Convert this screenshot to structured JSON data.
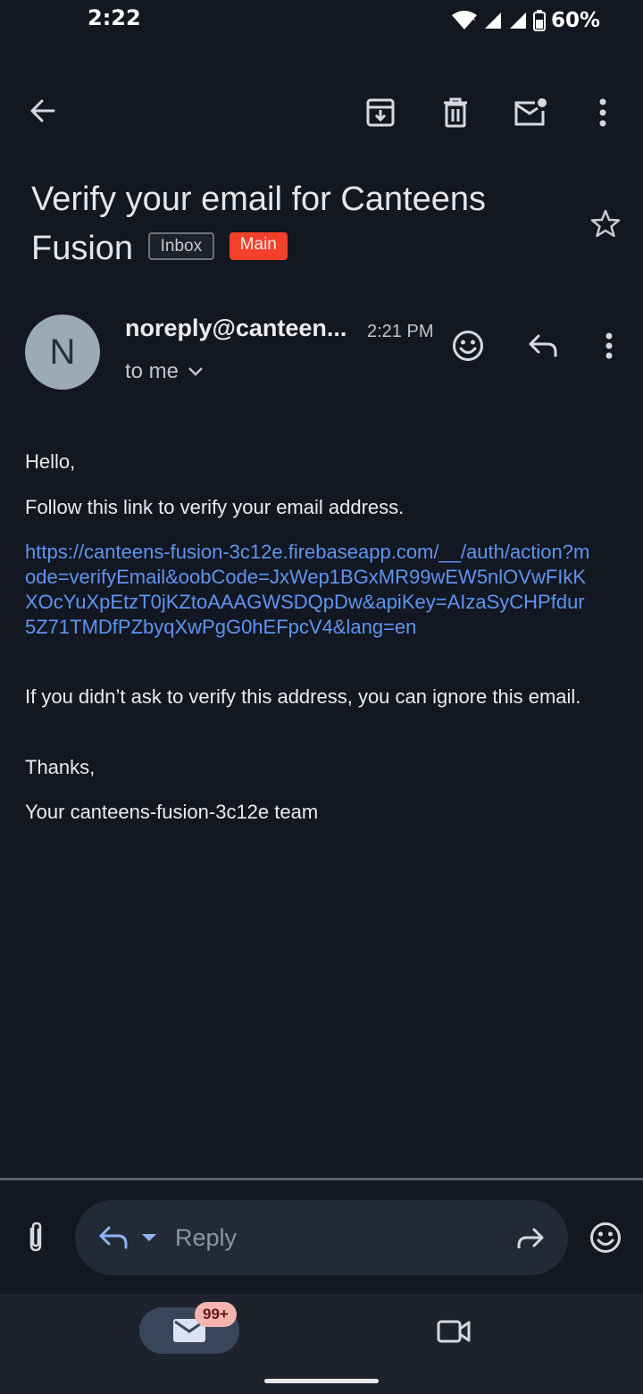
{
  "status_bar": {
    "time": "2:22",
    "battery_percent": "60%"
  },
  "email": {
    "subject": "Verify your email for Canteens Fusion",
    "labels": [
      "Inbox",
      "Main"
    ],
    "sender_initial": "N",
    "sender": "noreply@canteen...",
    "time": "2:21 PM",
    "recipient": "to me",
    "body": {
      "greeting": "Hello,",
      "instruction": "Follow this link to verify your email address.",
      "link": "https://canteens-fusion-3c12e.firebaseapp.com/__/auth/action?mode=verifyEmail&oobCode=JxWep1BGxMR99wEW5nlOVwFIkKXOcYuXpEtzT0jKZtoAAAGWSDQpDw&apiKey=AIzaSyCHPfdur5Z71TMDfPZbyqXwPgG0hEFpcV4&lang=en",
      "ignore_note": "If you didn’t ask to verify this address, you can ignore this email.",
      "thanks": "Thanks,",
      "signature": "Your canteens-fusion-3c12e team"
    }
  },
  "reply_bar": {
    "placeholder": "Reply"
  },
  "bottom_nav": {
    "mail_badge": "99+"
  },
  "colors": {
    "background": "#131722",
    "link": "#5e95f0",
    "main_chip": "#f2402b",
    "avatar": "#9aabb6"
  }
}
